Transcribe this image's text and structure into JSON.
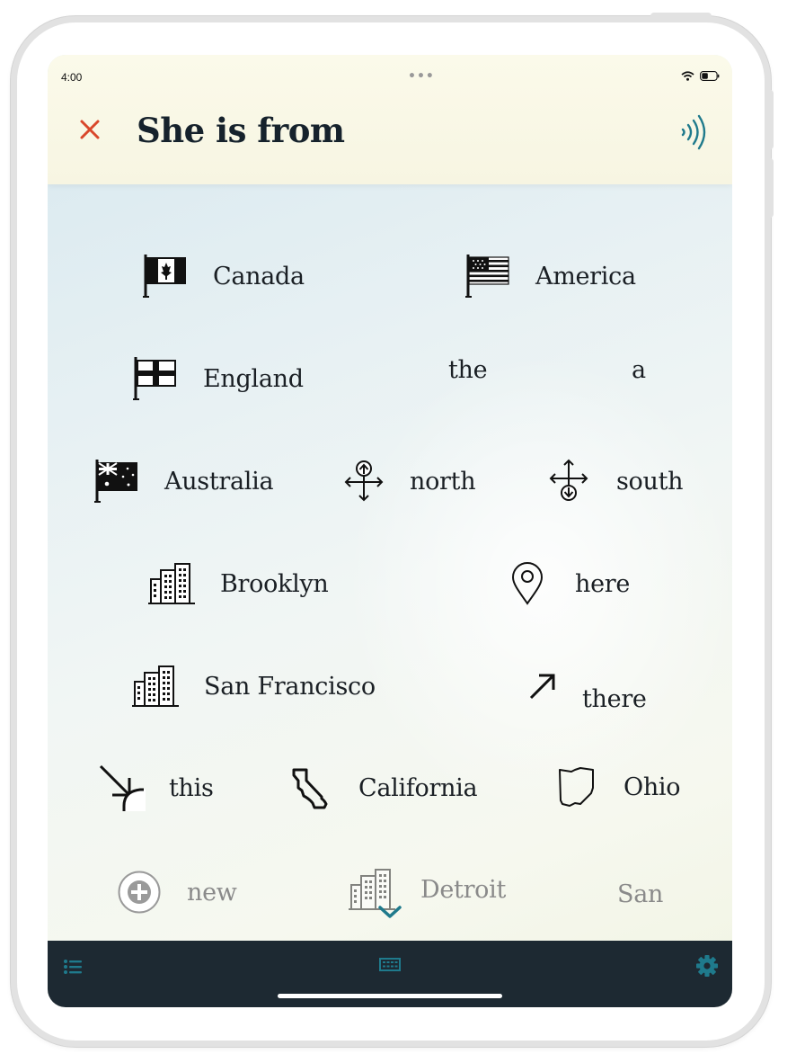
{
  "status_bar": {
    "time": "4:00",
    "dots": "•••"
  },
  "header": {
    "phrase": "She is from"
  },
  "colors": {
    "accent": "#1f7a8c",
    "close": "#d9472b",
    "bar": "#1d2932"
  },
  "words": [
    {
      "label": "Canada",
      "icon": "canada-flag-icon"
    },
    {
      "label": "America",
      "icon": "usa-flag-icon"
    },
    {
      "label": "England",
      "icon": "england-flag-icon"
    },
    {
      "label": "the",
      "icon": ""
    },
    {
      "label": "a",
      "icon": ""
    },
    {
      "label": "Australia",
      "icon": "australia-flag-icon"
    },
    {
      "label": "north",
      "icon": "compass-north-icon"
    },
    {
      "label": "south",
      "icon": "compass-south-icon"
    },
    {
      "label": "Brooklyn",
      "icon": "city-buildings-icon"
    },
    {
      "label": "here",
      "icon": "location-pin-icon"
    },
    {
      "label": "San Francisco",
      "icon": "city-buildings-icon"
    },
    {
      "label": "there",
      "icon": "arrow-up-right-icon"
    },
    {
      "label": "this",
      "icon": "arrow-this-icon"
    },
    {
      "label": "California",
      "icon": "california-shape-icon"
    },
    {
      "label": "Ohio",
      "icon": "ohio-shape-icon"
    },
    {
      "label": "new",
      "icon": "plus-circle-icon"
    },
    {
      "label": "Detroit",
      "icon": "city-buildings-icon"
    },
    {
      "label": "San",
      "icon": ""
    }
  ]
}
